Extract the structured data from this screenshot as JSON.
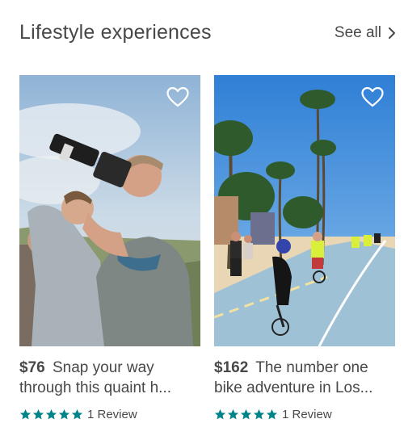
{
  "section": {
    "title": "Lifestyle experiences",
    "see_all": "See all"
  },
  "colors": {
    "text": "#484848",
    "star": "#008489",
    "heart_stroke": "#ffffff"
  },
  "cards": [
    {
      "price": "$76",
      "title_line1": "Snap your way",
      "title_line2": "through this quaint h...",
      "rating_stars": 5,
      "reviews": "1 Review",
      "photo_icon": "photographers-photo"
    },
    {
      "price": "$162",
      "title_line1": "The number one",
      "title_line2": "bike adventure in Los...",
      "rating_stars": 5,
      "reviews": "1 Review",
      "photo_icon": "beach-bike-path-photo"
    }
  ]
}
